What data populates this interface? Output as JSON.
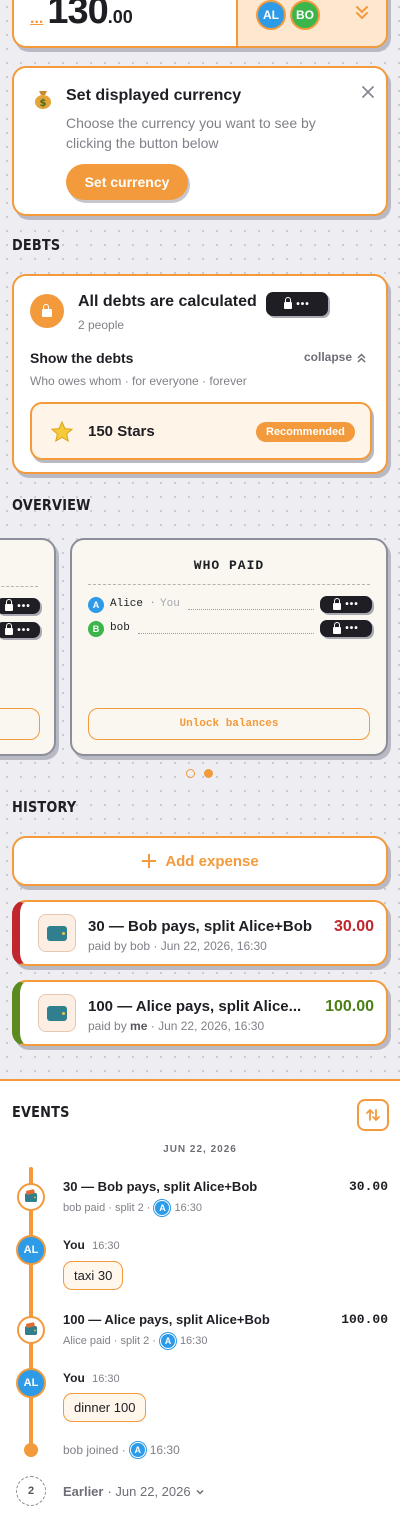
{
  "balance": {
    "prefix": "...",
    "amount": "130",
    "cents": ".00",
    "avatars": [
      "AL",
      "BO"
    ]
  },
  "currency_card": {
    "title": "Set displayed currency",
    "description": "Choose the currency you want to see by clicking the button below",
    "button": "Set currency",
    "icon": "money-bag-icon"
  },
  "debts": {
    "section_title": "DEBTS",
    "title": "All debts are calculated",
    "people": "2 people",
    "pill_dots": "•••",
    "show_title": "Show the debts",
    "collapse": "collapse",
    "subtitle": "Who owes whom · for everyone · forever",
    "stars": "150 Stars",
    "badge": "Recommended"
  },
  "overview": {
    "section_title": "OVERVIEW",
    "card_title": "WHO PAID",
    "rows": [
      {
        "initial": "A",
        "name": "Alice",
        "tag": "You",
        "color": "#2e9be8"
      },
      {
        "initial": "B",
        "name": "bob",
        "tag": "",
        "color": "#3cb64b"
      }
    ],
    "pill_dots": "•••",
    "unlock": "Unlock balances",
    "dots_active": 1
  },
  "history": {
    "section_title": "HISTORY",
    "add_expense": "Add expense",
    "items": [
      {
        "title": "30 — Bob pays, split Alice+Bob",
        "paid_by_prefix": "paid by",
        "paid_by": "bob",
        "date": "· Jun 22, 2026, 16:30",
        "amount": "30.00",
        "accent": "#c0262d",
        "amount_color": "#c0262d"
      },
      {
        "title": "100 — Alice pays, split Alice...",
        "paid_by_prefix": "paid by",
        "paid_by": "me",
        "date": "· Jun 22, 2026, 16:30",
        "amount": "100.00",
        "accent": "#5b8a1e",
        "amount_color": "#4b7f16"
      }
    ]
  },
  "events": {
    "section_title": "EVENTS",
    "date_header": "JUN 22, 2026",
    "entries": [
      {
        "title": "30 — Bob pays, split Alice+Bob",
        "amount": "30.00",
        "meta": "bob paid · split 2 ·",
        "time": "16:30"
      },
      {
        "name": "You",
        "time": "16:30",
        "message": "taxi 30"
      },
      {
        "title": "100 — Alice pays, split Alice+Bob",
        "amount": "100.00",
        "meta": "Alice paid · split 2 ·",
        "time": "16:30"
      },
      {
        "name": "You",
        "time": "16:30",
        "message": "dinner 100"
      }
    ],
    "joined": "bob joined ·",
    "joined_time": "16:30",
    "earlier_count": "2",
    "earlier": "Earlier",
    "earlier_date": "· Jun 22, 2026"
  },
  "colors": {
    "accent": "#f29a3c",
    "alice": "#2e9be8",
    "bob": "#3cb64b",
    "dark": "#1e1e24"
  }
}
